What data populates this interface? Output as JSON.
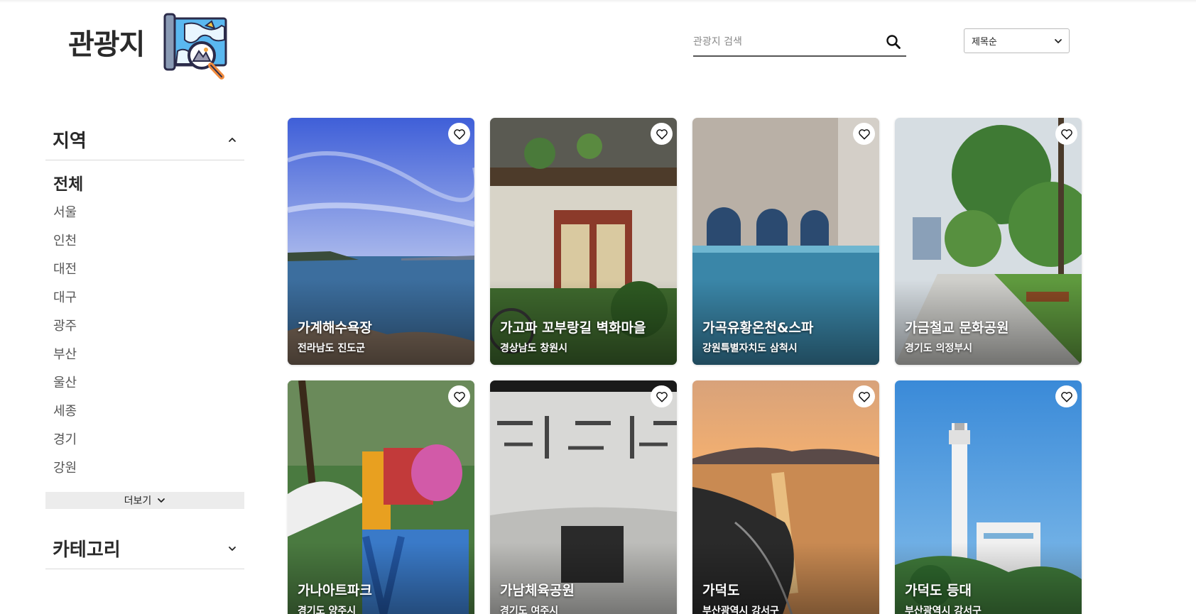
{
  "header": {
    "logo_text": "관광지",
    "search": {
      "placeholder": "관광지 검색",
      "value": ""
    },
    "sort": {
      "selected": "제목순"
    }
  },
  "sidebar": {
    "region": {
      "title": "지역",
      "items": [
        "전체",
        "서울",
        "인천",
        "대전",
        "대구",
        "광주",
        "부산",
        "울산",
        "세종",
        "경기",
        "강원"
      ],
      "active": "전체",
      "more_label": "더보기"
    },
    "category": {
      "title": "카테고리"
    }
  },
  "cards": [
    {
      "title": "가계해수욕장",
      "location": "전라남도 진도군"
    },
    {
      "title": "가고파 꼬부랑길 벽화마을",
      "location": "경상남도 창원시"
    },
    {
      "title": "가곡유황온천&스파",
      "location": "강원특별자치도 삼척시"
    },
    {
      "title": "가금철교 문화공원",
      "location": "경기도 의정부시"
    },
    {
      "title": "가나아트파크",
      "location": "경기도 양주시"
    },
    {
      "title": "가남체육공원",
      "location": "경기도 여주시"
    },
    {
      "title": "가덕도",
      "location": "부산광역시 강서구"
    },
    {
      "title": "가덕도 등대",
      "location": "부산광역시 강서구"
    }
  ]
}
